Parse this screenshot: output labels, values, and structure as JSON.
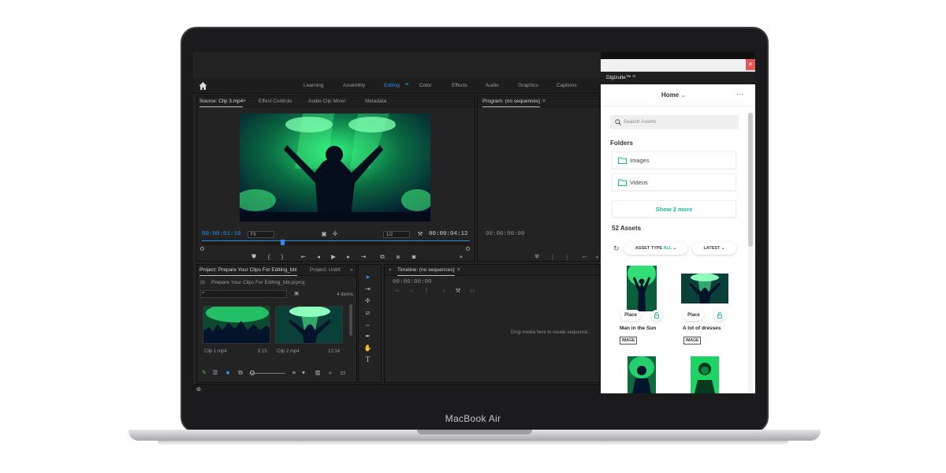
{
  "device": {
    "brand": "MacBook Air"
  },
  "colors": {
    "accent_blue": "#2d8ceb",
    "teal": "#1fb6a0",
    "green_tint": "#00e25a"
  },
  "premiere": {
    "workspaces": [
      "Learning",
      "Assembly",
      "Editing",
      "Color",
      "Effects",
      "Audio",
      "Graphics",
      "Captions"
    ],
    "active_workspace": "Editing",
    "source_panel": {
      "tabs": [
        "Source: Clip 3.mp4",
        "Effect Controls",
        "Audio Clip Mixer:",
        "Metadata"
      ],
      "timecode_in": "00:00:01:10",
      "fit": "Fit",
      "resolution": "1/2",
      "timecode_out": "00:00:04:12"
    },
    "program_panel": {
      "title": "Program: (no sequences)",
      "timecode": "00:00:00:00"
    },
    "project_panel": {
      "tabs": [
        "Project: Prepare Your Clips For Editing_bbl",
        "Project: Untitl"
      ],
      "file": "Prepare Your Clips For Editing_bbl.prproj",
      "item_count": "4 items",
      "clips": [
        {
          "name": "Clip 1.mp4",
          "duration": "5:15"
        },
        {
          "name": "Clip 2.mp4",
          "duration": "12:14"
        }
      ]
    },
    "timeline_panel": {
      "title": "Timeline: (no sequences)",
      "timecode": "00:00:00:00",
      "drop_hint": "Drop media here to create sequence."
    }
  },
  "digizuite": {
    "panel_title": "Digizuite™",
    "nav_title": "Home",
    "search_placeholder": "Search Assets",
    "folders_heading": "Folders",
    "folders": [
      "Images",
      "Videos"
    ],
    "show_more": "Show 2 more",
    "assets_heading": "52 Assets",
    "filter_asset_type_label": "ASSET TYPE",
    "filter_asset_type_value": "ALL",
    "filter_sort": "LATEST",
    "assets": [
      {
        "name": "Man in the Sun",
        "place_label": "Place",
        "type": "IMAGE"
      },
      {
        "name": "A lot of dresses",
        "place_label": "Place",
        "type": "IMAGE"
      }
    ]
  }
}
